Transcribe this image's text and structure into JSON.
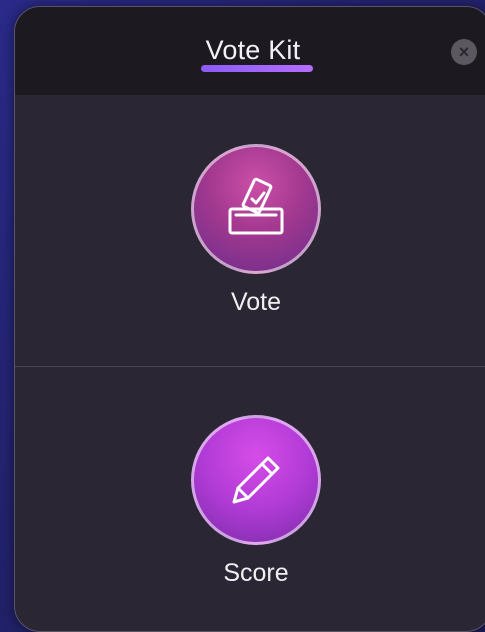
{
  "header": {
    "title": "Vote Kit"
  },
  "actions": {
    "vote_label": "Vote",
    "score_label": "Score"
  },
  "icons": {
    "close": "close-icon",
    "vote": "ballot-box-icon",
    "score": "pencil-icon"
  },
  "colors": {
    "accent": "#8b5cf6",
    "panel_bg": "#2b2633",
    "header_bg": "#1c1a20",
    "vote_circle": "#a2388f",
    "score_circle": "#b13bd6"
  }
}
